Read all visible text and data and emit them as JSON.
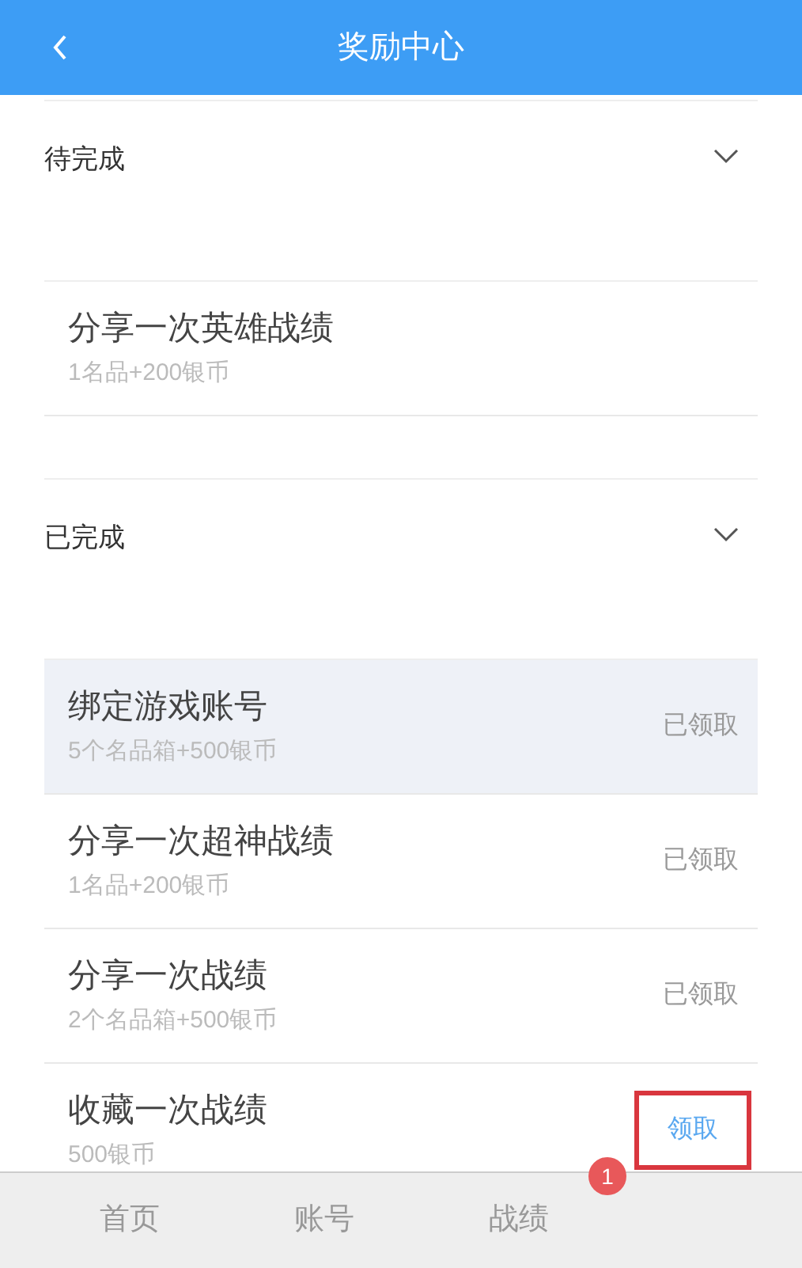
{
  "header": {
    "title": "奖励中心"
  },
  "sections": [
    {
      "title": "待完成",
      "expanded": true,
      "tasks": [
        {
          "name": "分享一次英雄战绩",
          "reward": "1名品+200银币",
          "selected": false,
          "kind": "pending"
        }
      ]
    },
    {
      "title": "已完成",
      "expanded": true,
      "tasks": [
        {
          "name": "绑定游戏账号",
          "reward": "5个名品箱+500银币",
          "selected": true,
          "kind": "claimed",
          "action": "已领取"
        },
        {
          "name": "分享一次超神战绩",
          "reward": "1名品+200银币",
          "selected": false,
          "kind": "claimed",
          "action": "已领取"
        },
        {
          "name": "分享一次战绩",
          "reward": "2个名品箱+500银币",
          "selected": false,
          "kind": "claimed",
          "action": "已领取"
        },
        {
          "name": "收藏一次战绩",
          "reward": "500银币",
          "selected": false,
          "kind": "claimable",
          "action": "领取",
          "highlighted": true
        }
      ]
    }
  ],
  "tab_bar": {
    "tabs": [
      {
        "label": "首页",
        "selected": false
      },
      {
        "label": "账号",
        "selected": false
      },
      {
        "label": "战绩",
        "selected": false
      }
    ],
    "badge": "1"
  }
}
